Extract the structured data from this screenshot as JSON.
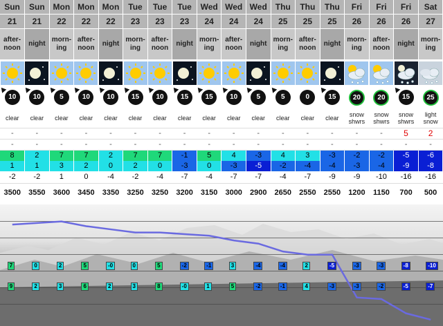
{
  "columns": [
    {
      "day": "Sun",
      "date": "21",
      "period": "after-\nnoon",
      "sky": "sun",
      "wind": "10",
      "dir": -40,
      "desc": "clear",
      "snow": "-",
      "rain": "-",
      "tmax": "8",
      "tmin": "1",
      "chill": "-2",
      "flevel": "3500"
    },
    {
      "day": "Sun",
      "date": "21",
      "period": "night",
      "sky": "moon",
      "wind": "10",
      "dir": -40,
      "desc": "clear",
      "snow": "-",
      "rain": "-",
      "tmax": "2",
      "tmin": "1",
      "chill": "-2",
      "flevel": "3550"
    },
    {
      "day": "Mon",
      "date": "22",
      "period": "morn-\ning",
      "sky": "sun",
      "wind": "5",
      "dir": -40,
      "desc": "clear",
      "snow": "-",
      "rain": "-",
      "tmax": "7",
      "tmin": "3",
      "chill": "1",
      "flevel": "3600"
    },
    {
      "day": "Mon",
      "date": "22",
      "period": "after-\nnoon",
      "sky": "sun",
      "wind": "10",
      "dir": -40,
      "desc": "clear",
      "snow": "-",
      "rain": "-",
      "tmax": "7",
      "tmin": "2",
      "chill": "0",
      "flevel": "3450"
    },
    {
      "day": "Mon",
      "date": "22",
      "period": "night",
      "sky": "moon",
      "wind": "10",
      "dir": -40,
      "desc": "clear",
      "snow": "-",
      "rain": "-",
      "tmax": "2",
      "tmin": "0",
      "chill": "-4",
      "flevel": "3350"
    },
    {
      "day": "Tue",
      "date": "23",
      "period": "morn-\ning",
      "sky": "sun",
      "wind": "15",
      "dir": -40,
      "desc": "clear",
      "snow": "-",
      "rain": "-",
      "tmax": "7",
      "tmin": "2",
      "chill": "-2",
      "flevel": "3250"
    },
    {
      "day": "Tue",
      "date": "23",
      "period": "after-\nnoon",
      "sky": "sun",
      "wind": "10",
      "dir": -40,
      "desc": "clear",
      "snow": "-",
      "rain": "-",
      "tmax": "7",
      "tmin": "0",
      "chill": "-4",
      "flevel": "3250"
    },
    {
      "day": "Tue",
      "date": "23",
      "period": "night",
      "sky": "moon",
      "wind": "15",
      "dir": -40,
      "desc": "clear",
      "snow": "-",
      "rain": "-",
      "tmax": "-1",
      "tmin": "-3",
      "chill": "-7",
      "flevel": "3200"
    },
    {
      "day": "Wed",
      "date": "24",
      "period": "morn-\ning",
      "sky": "sun",
      "wind": "15",
      "dir": -40,
      "desc": "clear",
      "snow": "-",
      "rain": "-",
      "tmax": "5",
      "tmin": "0",
      "chill": "-4",
      "flevel": "3150"
    },
    {
      "day": "Wed",
      "date": "24",
      "period": "after-\nnoon",
      "sky": "sun",
      "wind": "10",
      "dir": -40,
      "desc": "clear",
      "snow": "-",
      "rain": "-",
      "tmax": "4",
      "tmin": "-3",
      "chill": "-7",
      "flevel": "3000"
    },
    {
      "day": "Wed",
      "date": "24",
      "period": "night",
      "sky": "moon",
      "wind": "5",
      "dir": -40,
      "desc": "clear",
      "snow": "-",
      "rain": "-",
      "tmax": "-3",
      "tmin": "-5",
      "chill": "-7",
      "flevel": "2900"
    },
    {
      "day": "Thu",
      "date": "25",
      "period": "morn-\ning",
      "sky": "sun",
      "wind": "5",
      "dir": -40,
      "desc": "clear",
      "snow": "-",
      "rain": "-",
      "tmax": "4",
      "tmin": "-2",
      "chill": "-4",
      "flevel": "2650"
    },
    {
      "day": "Thu",
      "date": "25",
      "period": "after-\nnoon",
      "sky": "sun",
      "wind": "0",
      "dir": 0,
      "desc": "clear",
      "snow": "-",
      "rain": "-",
      "tmax": "3",
      "tmin": "-4",
      "chill": "-7",
      "flevel": "2550"
    },
    {
      "day": "Thu",
      "date": "25",
      "period": "night",
      "sky": "moon",
      "wind": "15",
      "dir": -40,
      "desc": "clear",
      "snow": "-",
      "rain": "-",
      "tmax": "-3",
      "tmin": "-4",
      "chill": "-9",
      "flevel": "2550"
    },
    {
      "day": "Fri",
      "date": "26",
      "period": "morn-\ning",
      "sky": "snowshower",
      "wind": "20",
      "dir": 0,
      "desc": "snow\nshwrs",
      "snow": "-",
      "rain": "-",
      "tmax": "-2",
      "tmin": "-3",
      "chill": "-9",
      "flevel": "1200",
      "green": true
    },
    {
      "day": "Fri",
      "date": "26",
      "period": "after-\nnoon",
      "sky": "snowshower",
      "wind": "20",
      "dir": 0,
      "desc": "snow\nshwrs",
      "snow": "-",
      "rain": "-",
      "tmax": "-2",
      "tmin": "-4",
      "chill": "-10",
      "flevel": "1150",
      "green": true
    },
    {
      "day": "Fri",
      "date": "26",
      "period": "night",
      "sky": "nightsnow",
      "wind": "15",
      "dir": -40,
      "desc": "snow\nshwrs",
      "snow": "5",
      "rain": "-",
      "tmax": "-5",
      "tmin": "-9",
      "chill": "-16",
      "flevel": "700"
    },
    {
      "day": "Sat",
      "date": "27",
      "period": "morn-\ning",
      "sky": "cloudsnow",
      "wind": "25",
      "dir": 0,
      "desc": "light\nsnow",
      "snow": "2",
      "rain": "-",
      "tmax": "-6",
      "tmin": "-8",
      "chill": "-16",
      "flevel": "500",
      "green": true
    }
  ],
  "graph": {
    "upper_tags": [
      "7",
      "0",
      "2",
      "5",
      "-0",
      "0",
      "5",
      "-2",
      "-1",
      "3",
      "-4",
      "-4",
      "2",
      "-5",
      "-3",
      "-3",
      "-8",
      "-10"
    ],
    "lower_tags": [
      "9",
      "2",
      "3",
      "6",
      "2",
      "3",
      "8",
      "-0",
      "1",
      "5",
      "-2",
      "-1",
      "4",
      "-3",
      "-3",
      "-2",
      "-5",
      "-7"
    ]
  },
  "colors": {
    "green": "#1fd87a",
    "cyan": "#22e0e6",
    "blue": "#1a66e6",
    "darkblue": "#0a1fd4",
    "line": "#6a6ae0"
  }
}
